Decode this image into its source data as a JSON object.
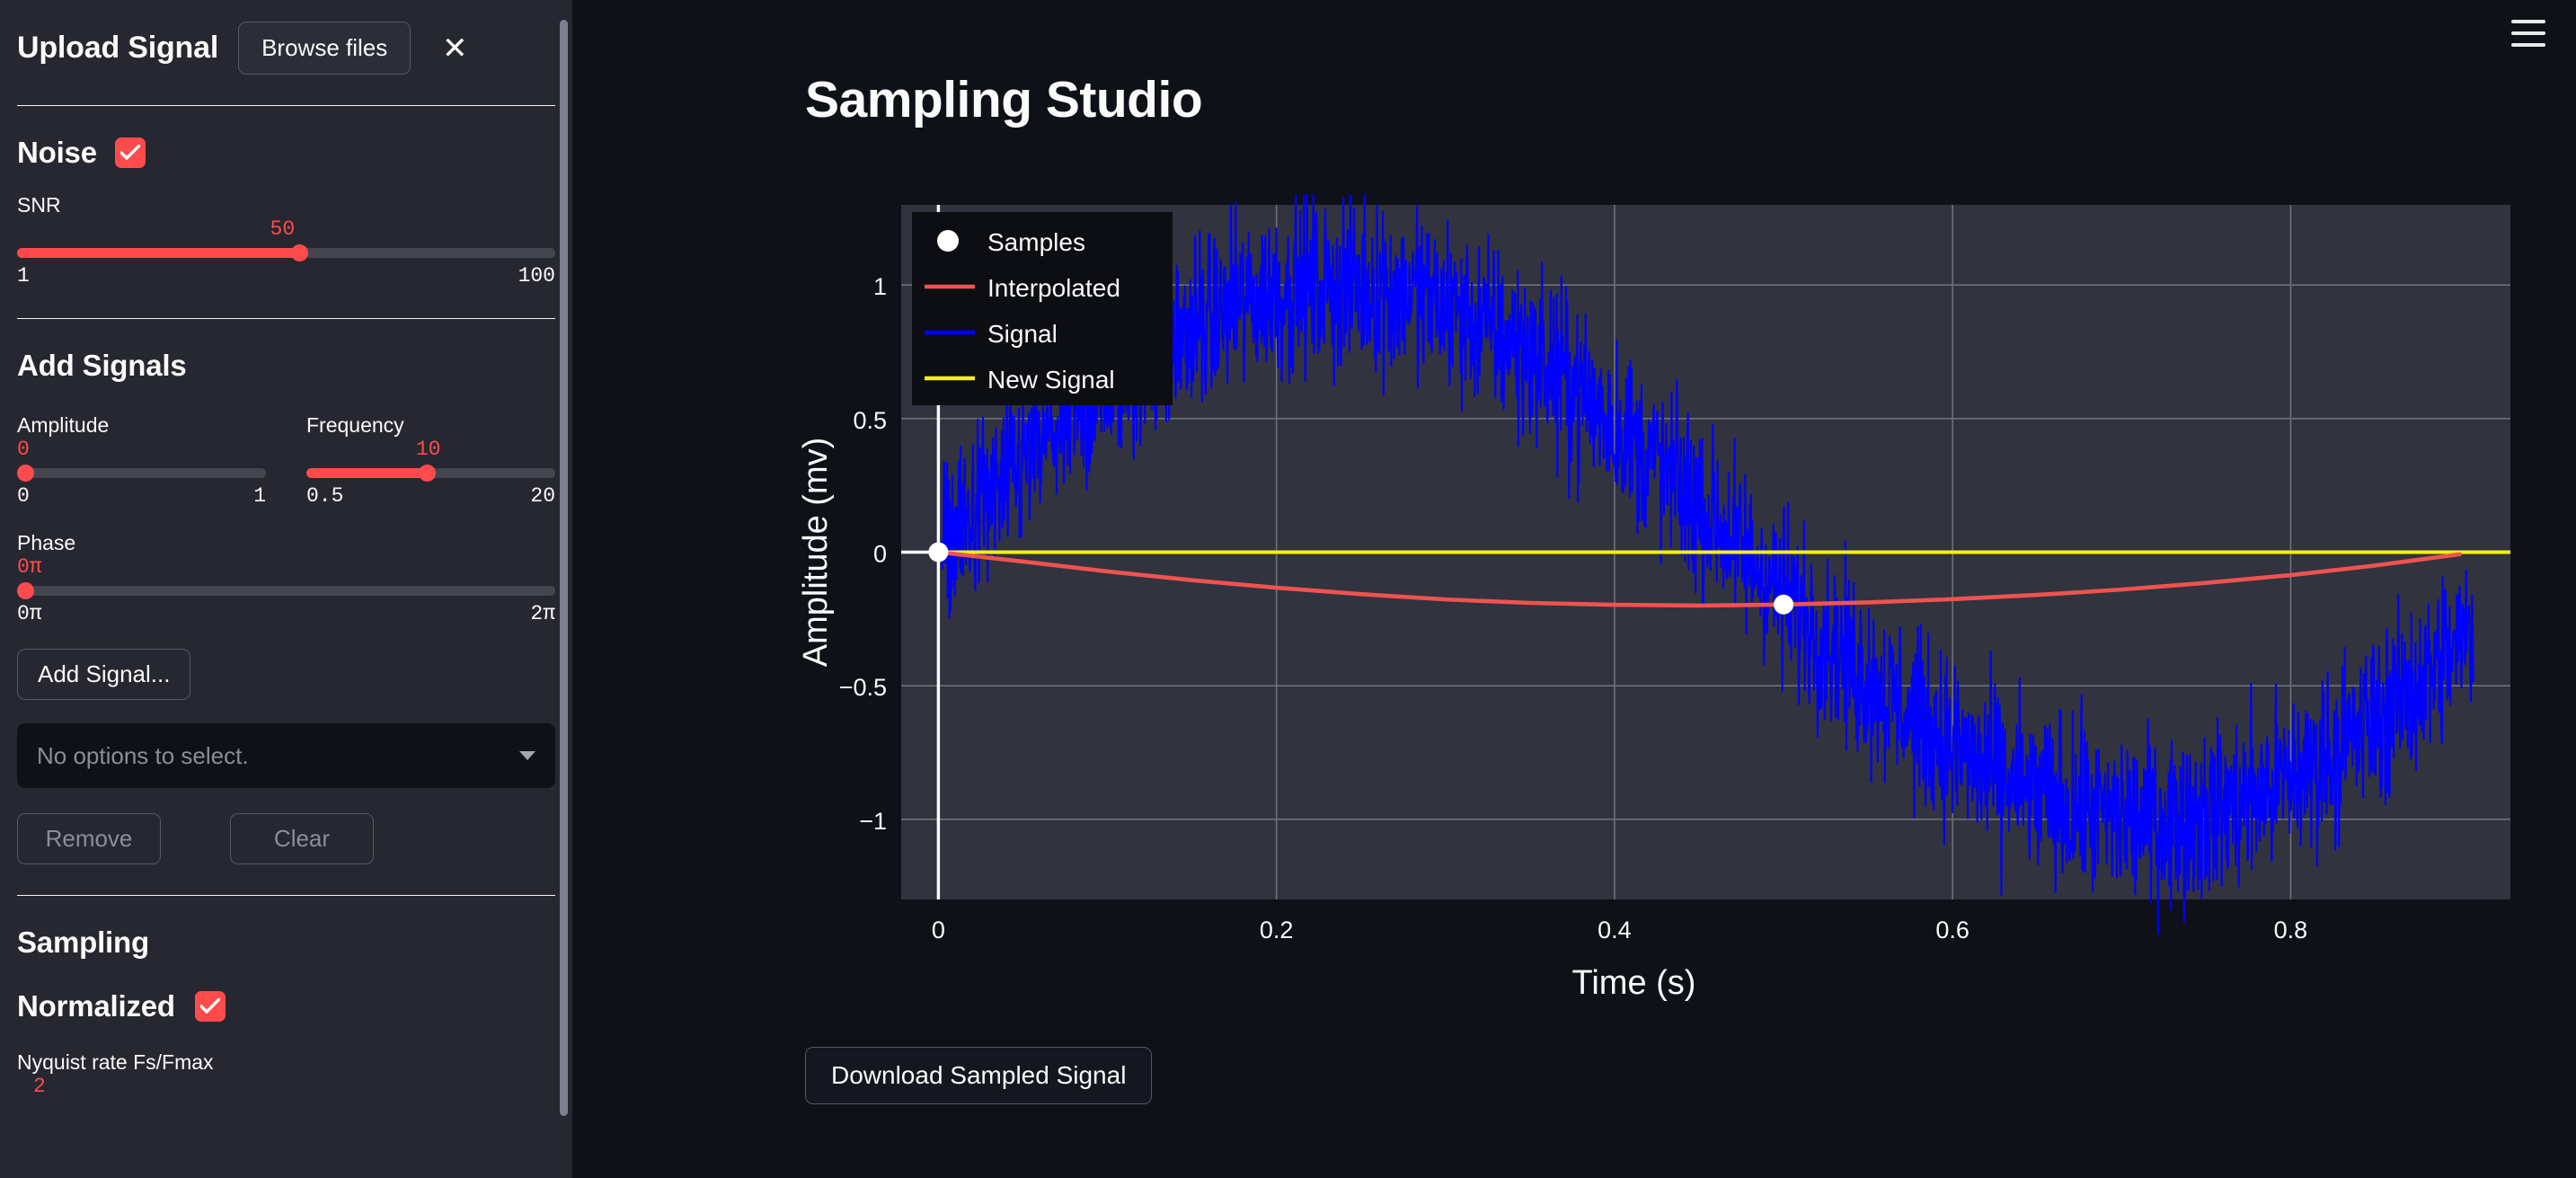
{
  "sidebar": {
    "upload": {
      "title": "Upload Signal",
      "browse_label": "Browse files",
      "close_icon": "close-icon"
    },
    "noise": {
      "title": "Noise",
      "enabled": true,
      "snr": {
        "label": "SNR",
        "value": "50",
        "min": "1",
        "max": "100",
        "pct": 50
      }
    },
    "add_signals": {
      "title": "Add Signals",
      "amplitude": {
        "label": "Amplitude",
        "value": "0",
        "min": "0",
        "max": "1",
        "pct": 0
      },
      "frequency": {
        "label": "Frequency",
        "value": "10",
        "min": "0.5",
        "max": "20",
        "pct": 48
      },
      "phase": {
        "label": "Phase",
        "value": "0π",
        "min": "0π",
        "max": "2π",
        "pct": 0
      },
      "add_signal_label": "Add Signal...",
      "select_placeholder": "No options to select.",
      "remove_label": "Remove",
      "clear_label": "Clear"
    },
    "sampling": {
      "title": "Sampling",
      "normalized_label": "Normalized",
      "normalized_enabled": true,
      "nyquist": {
        "label": "Nyquist rate Fs/Fmax",
        "value": "2"
      }
    }
  },
  "main": {
    "title": "Sampling Studio",
    "menu_icon": "hamburger-menu-icon",
    "download_label": "Download Sampled Signal"
  },
  "colors": {
    "accent": "#ff4b4b",
    "signal": "#0000ff",
    "interpolated": "#ef5350",
    "new_signal": "#f2f20d",
    "samples": "#ffffff",
    "sidebar_bg": "#262730",
    "main_bg": "#0e1117",
    "plot_bg": "#31333f"
  },
  "chart_data": {
    "type": "line",
    "title": "",
    "xlabel": "Time (s)",
    "ylabel": "Amplitude (mv)",
    "xlim": [
      -0.022,
      0.93
    ],
    "ylim": [
      -1.3,
      1.3
    ],
    "xticks": [
      "0",
      "0.2",
      "0.4",
      "0.6",
      "0.8"
    ],
    "xtick_values": [
      0,
      0.2,
      0.4,
      0.6,
      0.8
    ],
    "yticks": [
      "1",
      "0.5",
      "0",
      "−0.5",
      "−1"
    ],
    "ytick_values": [
      1,
      0.5,
      0,
      -0.5,
      -1
    ],
    "grid": true,
    "legend_position": "upper-left",
    "legend": [
      {
        "label": "Samples",
        "marker": "dot",
        "color": "#ffffff"
      },
      {
        "label": "Interpolated",
        "marker": "line",
        "color": "#ef5350"
      },
      {
        "label": "Signal",
        "marker": "line",
        "color": "#0000ff"
      },
      {
        "label": "New Signal",
        "marker": "line",
        "color": "#f2f20d"
      }
    ],
    "series": [
      {
        "name": "Signal",
        "type": "noisy-sine",
        "color": "#0000ff",
        "amplitude": 1.0,
        "frequency": 1.05,
        "phase": 0,
        "noise_amplitude": 0.16,
        "description": "Noisy 1 Hz sine wave spanning t=0 to 0.93 s, amplitude 1 mv"
      },
      {
        "name": "Interpolated",
        "type": "line",
        "color": "#ef5350",
        "x": [
          0.0,
          0.05,
          0.1,
          0.15,
          0.2,
          0.25,
          0.3,
          0.35,
          0.4,
          0.45,
          0.5,
          0.55,
          0.6,
          0.65,
          0.7,
          0.75,
          0.8,
          0.85,
          0.9
        ],
        "y": [
          0.0,
          -0.035,
          -0.072,
          -0.105,
          -0.133,
          -0.157,
          -0.177,
          -0.19,
          -0.197,
          -0.2,
          -0.196,
          -0.188,
          -0.176,
          -0.16,
          -0.14,
          -0.115,
          -0.086,
          -0.05,
          -0.008
        ]
      },
      {
        "name": "New Signal",
        "type": "line",
        "color": "#f2f20d",
        "x": [
          0.0,
          0.93
        ],
        "y": [
          0.0,
          0.0
        ]
      }
    ],
    "samples": {
      "name": "Samples",
      "color": "#ffffff",
      "x": [
        0.0,
        0.5
      ],
      "y": [
        0.0,
        -0.196
      ]
    },
    "annotations": [
      {
        "type": "vline",
        "x": 0.0,
        "color": "#ffffff"
      },
      {
        "type": "hline",
        "y": 0.0,
        "color": "#ffffff",
        "x_to": 0.0
      }
    ]
  }
}
